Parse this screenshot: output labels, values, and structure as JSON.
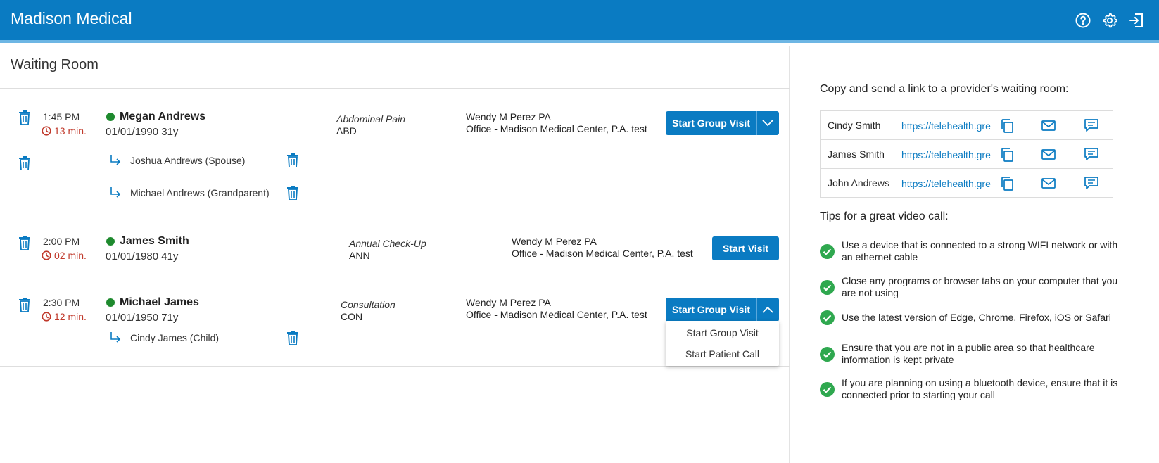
{
  "app": {
    "title": "Madison Medical"
  },
  "header_icons": [
    "help-icon",
    "gear-icon",
    "logout-icon"
  ],
  "waiting_room": {
    "title": "Waiting Room",
    "patients": [
      {
        "time": "1:45 PM",
        "wait": "13 min.",
        "name": "Megan Andrews",
        "dob": "01/01/1990 31y",
        "reason": "Abdominal Pain",
        "code": "ABD",
        "provider": "Wendy M Perez PA",
        "location": "Office - Madison Medical Center, P.A. test",
        "action": "Start Group Visit",
        "participants": [
          "Joshua Andrews (Spouse)",
          "Michael Andrews (Grandparent)"
        ]
      },
      {
        "time": "2:00 PM",
        "wait": "02 min.",
        "name": "James Smith",
        "dob": "01/01/1980 41y",
        "reason": "Annual Check-Up",
        "code": "ANN",
        "provider": "Wendy M Perez PA",
        "location": "Office - Madison Medical Center, P.A. test",
        "action": "Start Visit",
        "participants": []
      },
      {
        "time": "2:30 PM",
        "wait": "12 min.",
        "name": "Michael James",
        "dob": "01/01/1950 71y",
        "reason": "Consultation",
        "code": "CON",
        "provider": "Wendy M Perez PA",
        "location": "Office - Madison Medical Center, P.A. test",
        "action": "Start Group Visit",
        "participants": [
          "Cindy James (Child)"
        ]
      }
    ],
    "dropdown_options": [
      "Start Group Visit",
      "Start Patient Call"
    ]
  },
  "sidebar": {
    "copy_title": "Copy and send a link to a provider's waiting room:",
    "links": [
      {
        "name": "Cindy Smith",
        "url": "https://telehealth.gre"
      },
      {
        "name": "James Smith",
        "url": "https://telehealth.gre"
      },
      {
        "name": "John Andrews",
        "url": "https://telehealth.gre"
      }
    ],
    "tips_title": "Tips for a great video call:",
    "tips": [
      "Use a device that is connected to a strong WIFI network or with an ethernet cable",
      "Close any programs or browser tabs on your computer that you are not using",
      "Use the latest version of Edge, Chrome, Firefox, iOS or Safari",
      "Ensure that you are not in a public area so that healthcare information is kept private",
      "If you are planning on using a bluetooth device, ensure that it is connected prior to starting your call"
    ]
  },
  "colors": {
    "brand": "#0a7bc2",
    "waiting": "#c0392b",
    "online": "#1e8a2e",
    "check": "#2fa84f"
  }
}
